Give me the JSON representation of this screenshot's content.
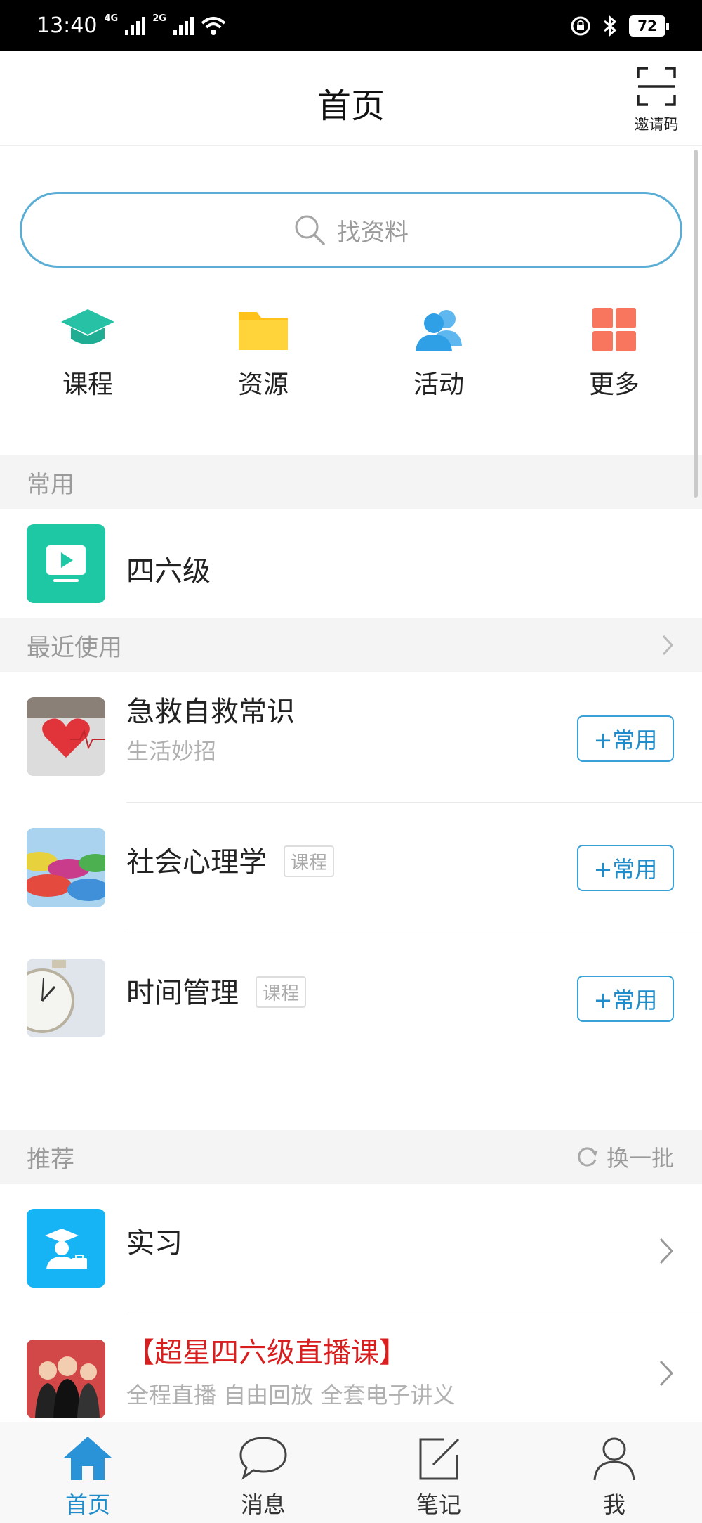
{
  "status_bar": {
    "time": "13:40",
    "net1": "4G",
    "net2": "2G",
    "battery": "72"
  },
  "header": {
    "title": "首页",
    "invite_label": "邀请码"
  },
  "search": {
    "placeholder": "找资料"
  },
  "shortcuts": [
    {
      "label": "课程",
      "icon": "graduation-cap-icon",
      "color": "#27c2a6"
    },
    {
      "label": "资源",
      "icon": "folder-icon",
      "color": "#ffc21a"
    },
    {
      "label": "活动",
      "icon": "people-icon",
      "color": "#2f9fe6"
    },
    {
      "label": "更多",
      "icon": "grid-icon",
      "color": "#f8765e"
    }
  ],
  "sections": {
    "common": {
      "title": "常用"
    },
    "recent": {
      "title": "最近使用"
    },
    "recommend": {
      "title": "推荐",
      "action": "换一批"
    }
  },
  "common_items": [
    {
      "title": "四六级",
      "icon": "video-play-icon",
      "color": "#1ec8a5"
    }
  ],
  "recent_items": [
    {
      "title": "急救自救常识",
      "subtitle": "生活妙招",
      "button": "+常用"
    },
    {
      "title": "社会心理学",
      "tag": "课程",
      "button": "+常用"
    },
    {
      "title": "时间管理",
      "tag": "课程",
      "button": "+常用"
    }
  ],
  "recommend_items": [
    {
      "title": "实习",
      "icon": "internship-icon",
      "color": "#16b3f5"
    },
    {
      "title": "【超星四六级直播课】",
      "subtitle": "全程直播  自由回放  全套电子讲义",
      "title_color": "#d81e1e"
    }
  ],
  "bottom_nav": [
    {
      "label": "首页",
      "active": true
    },
    {
      "label": "消息",
      "active": false
    },
    {
      "label": "笔记",
      "active": false
    },
    {
      "label": "我",
      "active": false
    }
  ],
  "colors": {
    "accent": "#1f8ccc",
    "section_bg": "#f4f4f4"
  }
}
